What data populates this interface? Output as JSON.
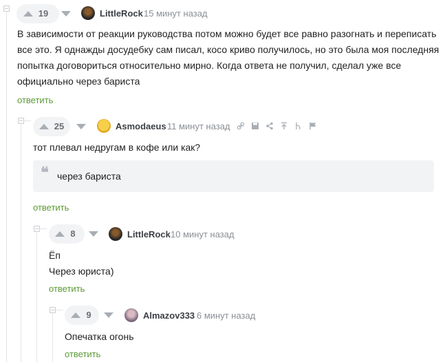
{
  "comments": [
    {
      "rating": "19",
      "author": "LittleRock",
      "time": "15 минут назад",
      "lines": [
        "В зависимости от реакции руководства потом можно будет все равно разогнать и переписать",
        "все это. Я однажды досудебку сам писал, косо криво получилось, но это была моя последняя",
        "попытка договориться относительно мирно. Когда ответа не получил, сделал уже все",
        "официально через бариста"
      ],
      "reply_label": "ответить"
    },
    {
      "rating": "25",
      "author": "Asmodaeus",
      "time": "11 минут назад",
      "lines": [
        "тот плевал недругам в кофе или как?"
      ],
      "quote": "через бариста",
      "reply_label": "ответить"
    },
    {
      "rating": "8",
      "author": "LittleRock",
      "time": "10 минут назад",
      "lines": [
        "Ёп",
        "Через юриста)"
      ],
      "reply_label": "ответить"
    },
    {
      "rating": "9",
      "author": "Almazov333",
      "time": "6 минут назад",
      "lines": [
        "Опечатка огонь"
      ],
      "reply_label": "ответить"
    }
  ],
  "tools": [
    "link-icon",
    "save-icon",
    "share-icon",
    "pin-icon",
    "branch-icon",
    "flag-icon"
  ],
  "colors": {
    "reply": "#5b9a34",
    "arrow": "#a9aeb4",
    "rating_bg": "#f2f3f5"
  }
}
